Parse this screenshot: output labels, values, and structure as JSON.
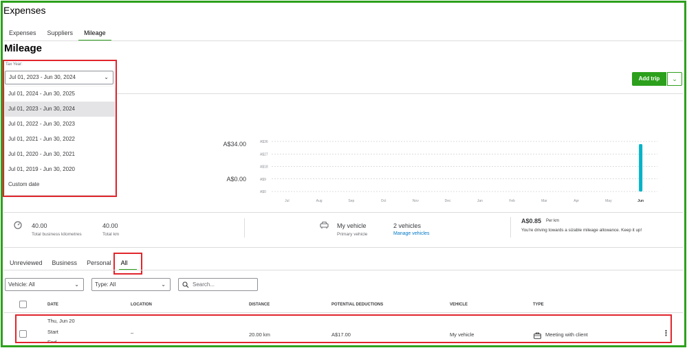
{
  "app_title": "Expenses",
  "top_tabs": [
    "Expenses",
    "Suppliers",
    "Mileage"
  ],
  "page_title": "Mileage",
  "tax_year": {
    "label": "Tax Year:",
    "selected": "Jul 01, 2023 - Jun 30, 2024",
    "options": [
      "Jul 01, 2024 - Jun 30, 2025",
      "Jul 01, 2023 - Jun 30, 2024",
      "Jul 01, 2022 - Jun 30, 2023",
      "Jul 01, 2021 - Jun 30, 2022",
      "Jul 01, 2020 - Jun 30, 2021",
      "Jul 01, 2019 - Jun 30, 2020",
      "Custom date"
    ]
  },
  "add_trip_label": "Add trip",
  "summary": {
    "amount_top": "A$34.00",
    "amount_bottom": "A$0.00"
  },
  "chart_data": {
    "type": "bar",
    "categories": [
      "Jul",
      "Aug",
      "Sep",
      "Oct",
      "Nov",
      "Dec",
      "Jan",
      "Feb",
      "Mar",
      "Apr",
      "May",
      "Jun"
    ],
    "y_tick_labels": [
      "A$36",
      "A$27",
      "A$18",
      "A$9",
      "A$0"
    ],
    "ylim": [
      0,
      36
    ],
    "series": [
      {
        "values": [
          0,
          0,
          0,
          0,
          0,
          0,
          0,
          0,
          0,
          0,
          0,
          34
        ]
      }
    ],
    "bar_color": "#00b3c7",
    "grid": true
  },
  "stats": {
    "business_km_value": "40.00",
    "business_km_label": "Total business kilometres",
    "total_km_value": "40.00",
    "total_km_label": "Total km",
    "vehicle_name": "My vehicle",
    "vehicle_sub": "Primary vehicle",
    "vehicle_count": "2 vehicles",
    "manage_link": "Manage vehicles",
    "rate_value": "A$0.85",
    "rate_unit": "Per km",
    "rate_note": "You're driving towards a sizable mileage allowance. Keep it up!"
  },
  "filter_tabs": [
    "Unreviewed",
    "Business",
    "Personal",
    "All"
  ],
  "filters": {
    "vehicle": "Vehicle: All",
    "type": "Type: All",
    "search_placeholder": "Search..."
  },
  "table": {
    "headers": [
      "DATE",
      "LOCATION",
      "DISTANCE",
      "POTENTIAL DEDUCTIONS",
      "VEHICLE",
      "TYPE"
    ],
    "row": {
      "date": "Thu, Jun 20",
      "start": "Start",
      "end": "End",
      "location": "–",
      "distance": "20.00 km",
      "deduction": "A$17.00",
      "vehicle": "My vehicle",
      "type": "Meeting with client"
    }
  },
  "colors": {
    "accent": "#2ca01c",
    "highlight": "#e0242c",
    "link": "#0077c5"
  }
}
